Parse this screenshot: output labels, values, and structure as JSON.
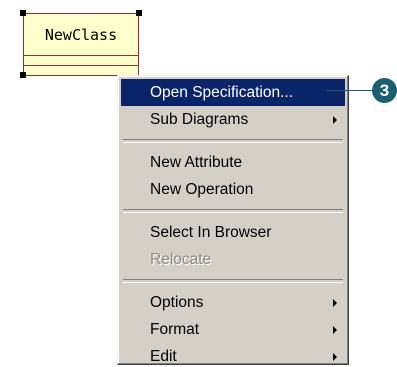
{
  "uml_class": {
    "name": "NewClass"
  },
  "context_menu": {
    "items": [
      {
        "label": "Open Specification...",
        "highlighted": true,
        "disabled": false,
        "has_submenu": false
      },
      {
        "label": "Sub Diagrams",
        "highlighted": false,
        "disabled": false,
        "has_submenu": true
      },
      {
        "label": "New Attribute",
        "highlighted": false,
        "disabled": false,
        "has_submenu": false
      },
      {
        "label": "New Operation",
        "highlighted": false,
        "disabled": false,
        "has_submenu": false
      },
      {
        "label": "Select In Browser",
        "highlighted": false,
        "disabled": false,
        "has_submenu": false
      },
      {
        "label": "Relocate",
        "highlighted": false,
        "disabled": true,
        "has_submenu": false
      },
      {
        "label": "Options",
        "highlighted": false,
        "disabled": false,
        "has_submenu": true
      },
      {
        "label": "Format",
        "highlighted": false,
        "disabled": false,
        "has_submenu": true
      },
      {
        "label": "Edit",
        "highlighted": false,
        "disabled": false,
        "has_submenu": true
      }
    ]
  },
  "callout": {
    "number": "3"
  },
  "colors": {
    "class_fill": "#ffffcc",
    "class_border": "#9c2b2b",
    "menu_background": "#d4d0c8",
    "highlight": "#0a246a",
    "callout": "#1c5f6e"
  },
  "icons": {
    "submenu_arrow": "triangle-right",
    "selection_handle": "black-square"
  }
}
